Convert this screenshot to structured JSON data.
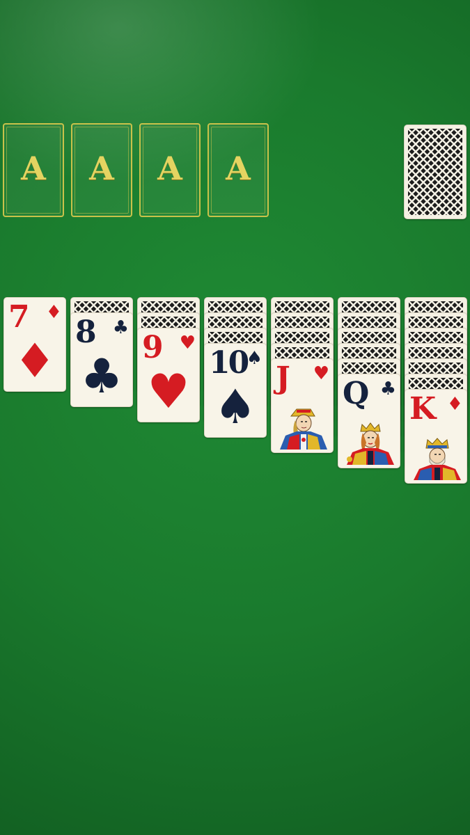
{
  "foundations": [
    {
      "label": "A"
    },
    {
      "label": "A"
    },
    {
      "label": "A"
    },
    {
      "label": "A"
    }
  ],
  "stock": {
    "face_down": true
  },
  "tableau": [
    {
      "face_down_count": 0,
      "top_card": {
        "rank": "7",
        "suit": "♦",
        "suit_name": "diamonds",
        "color": "red"
      }
    },
    {
      "face_down_count": 1,
      "top_card": {
        "rank": "8",
        "suit": "♣",
        "suit_name": "clubs",
        "color": "black"
      }
    },
    {
      "face_down_count": 2,
      "top_card": {
        "rank": "9",
        "suit": "♥",
        "suit_name": "hearts",
        "color": "red"
      }
    },
    {
      "face_down_count": 3,
      "top_card": {
        "rank": "10",
        "suit": "♠",
        "suit_name": "spades",
        "color": "black"
      }
    },
    {
      "face_down_count": 4,
      "top_card": {
        "rank": "J",
        "suit": "♥",
        "suit_name": "hearts",
        "color": "red"
      }
    },
    {
      "face_down_count": 5,
      "top_card": {
        "rank": "Q",
        "suit": "♣",
        "suit_name": "clubs",
        "color": "black"
      }
    },
    {
      "face_down_count": 6,
      "top_card": {
        "rank": "K",
        "suit": "♦",
        "suit_name": "diamonds",
        "color": "red"
      }
    }
  ],
  "colors": {
    "felt": "#1a7a2d",
    "foundation_outline": "#c9c24a",
    "suit_red": "#d51c22",
    "suit_black": "#15223d",
    "card_face": "#f8f4e8"
  }
}
